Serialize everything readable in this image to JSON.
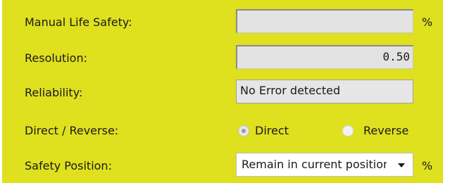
{
  "form": {
    "manual_life_safety": {
      "label": "Manual Life Safety:",
      "value": "",
      "unit": "%"
    },
    "resolution": {
      "label": "Resolution:",
      "value": "0.50"
    },
    "reliability": {
      "label": "Reliability:",
      "value": "No Error detected"
    },
    "direction": {
      "label": "Direct / Reverse:",
      "options": [
        {
          "label": "Direct",
          "selected": true
        },
        {
          "label": "Reverse",
          "selected": false
        }
      ]
    },
    "safety_position": {
      "label": "Safety Position:",
      "value": "Remain in current position",
      "unit": "%"
    }
  },
  "colors": {
    "panel_bg": "#dfe01e",
    "field_bg": "#e3e3e3"
  },
  "icons": {
    "dropdown": "chevron-down-icon",
    "radio": "radio-icon"
  }
}
